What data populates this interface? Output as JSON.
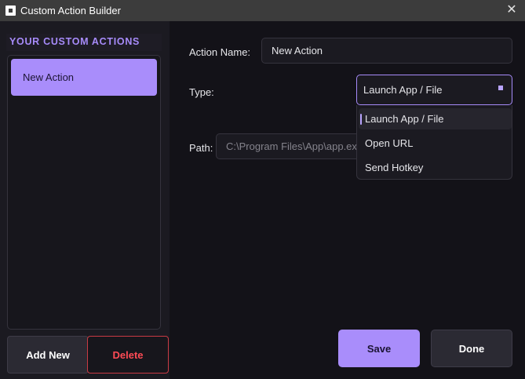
{
  "window": {
    "title": "Custom Action Builder",
    "close_glyph": "✕",
    "icon": "app-icon"
  },
  "sidebar": {
    "title": "YOUR CUSTOM ACTIONS",
    "items": [
      {
        "label": "New Action",
        "selected": true
      }
    ],
    "add_label": "Add New",
    "delete_label": "Delete"
  },
  "form": {
    "name_label": "Action Name:",
    "name_value": "New Action",
    "type_label": "Type:",
    "type_value": "Launch App / File",
    "type_options": [
      "Launch App / File",
      "Open URL",
      "Send Hotkey"
    ],
    "path_label": "Path:",
    "path_placeholder": "C:\\Program Files\\App\\app.exe"
  },
  "footer": {
    "save_label": "Save",
    "done_label": "Done"
  },
  "colors": {
    "accent": "#a98dfb",
    "danger": "#ff4b55",
    "background": "#131218",
    "panel": "#1b1a21"
  }
}
